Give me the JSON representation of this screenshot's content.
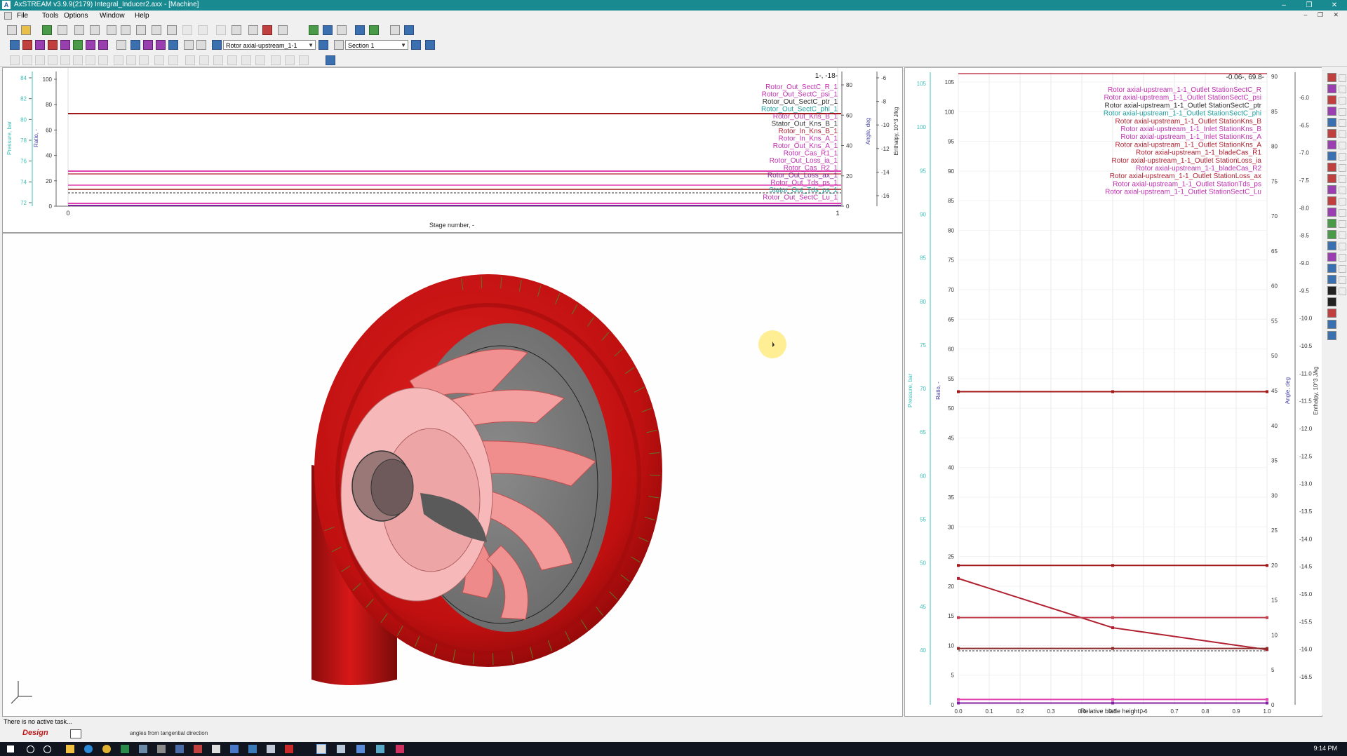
{
  "window": {
    "title": "AxSTREAM  v3.9.9(2179)  Integral_Inducer2.axx - [Machine]",
    "controls": [
      "–",
      "❐",
      "✕"
    ]
  },
  "menu": {
    "items": [
      "File",
      "Tools",
      "Options",
      "Window",
      "Help"
    ]
  },
  "toolbar": {
    "object_select": "Rotor axial-upstream_1-1",
    "section_select": "Section 1"
  },
  "top_chart": {
    "readout": "1-, -18-",
    "x_label": "Stage number, -",
    "y_labels": {
      "pressure": "Pressure, bar",
      "ratio": "Ratio, -",
      "angle": "Angle, deg",
      "enthalpy": "Enthalpy, 10^3 J/kg"
    },
    "colors": {
      "pressure": "#40c0b8",
      "ratio": "#4040a0",
      "angle": "#4040a0",
      "enthalpy": "#303030",
      "dark_red": "#a01818",
      "pink": "#e040b0",
      "purple": "#8020a0"
    },
    "legend": [
      {
        "text": "Rotor_Out_SectC_R_1",
        "color": "#c030b0"
      },
      {
        "text": "Rotor_Out_SectC_psi_1",
        "color": "#c030b0"
      },
      {
        "text": "Rotor_Out_SectC_ptr_1",
        "color": "#303030"
      },
      {
        "text": "Rotor_Out_SectC_phi_1",
        "color": "#20a0a0"
      },
      {
        "text": "Rotor_Out_Kns_B_1",
        "color": "#c030b0"
      },
      {
        "text": "Stator_Out_Kns_B_1",
        "color": "#303030"
      },
      {
        "text": "Rotor_In_Kns_B_1",
        "color": "#b02030"
      },
      {
        "text": "Rotor_In_Kns_A_1",
        "color": "#c030b0"
      },
      {
        "text": "Rotor_Out_Kns_A_1",
        "color": "#c030b0"
      },
      {
        "text": "Rotor_Cas_R1_1",
        "color": "#c030b0"
      },
      {
        "text": "Rotor_Out_Loss_ia_1",
        "color": "#c030b0"
      },
      {
        "text": "Rotor_Cas_R2_1",
        "color": "#c030b0"
      },
      {
        "text": "Rotor_Out_Loss_ax_1",
        "color": "#8020a0"
      },
      {
        "text": "Rotor_Out_Tds_ps_1",
        "color": "#c030b0"
      },
      {
        "text": "Stator_Out_Tds_ps_1",
        "color": "#20a0a0"
      },
      {
        "text": "Rotor_Out_SectC_Lu_1",
        "color": "#c030b0"
      }
    ],
    "axis_pressure_ticks": [
      "84",
      "82",
      "80",
      "78",
      "76",
      "74",
      "72"
    ],
    "axis_ratio_ticks": [
      "100",
      "80",
      "60",
      "40",
      "20",
      "0"
    ],
    "axis_angle_ticks": [
      "80",
      "60",
      "40",
      "20",
      "0"
    ],
    "axis_enthalpy_ticks": [
      "-6",
      "-8",
      "-10",
      "-12",
      "-14",
      "-16"
    ],
    "x_ticks": [
      "0",
      "1"
    ]
  },
  "right_chart": {
    "readout": "-0.06-, 69.8-",
    "x_label": "Relative blade height, -",
    "y_labels": {
      "pressure": "Pressure, bar",
      "ratio": "Ratio, -",
      "angle": "Angle, deg",
      "enthalpy": "Enthalpy, 10^3 J/kg"
    },
    "legend": [
      {
        "text": "Rotor axial-upstream_1-1_Outlet StationSectC_R",
        "color": "#c030b0"
      },
      {
        "text": "Rotor axial-upstream_1-1_Outlet StationSectC_psi",
        "color": "#c030b0"
      },
      {
        "text": "Rotor axial-upstream_1-1_Outlet StationSectC_ptr",
        "color": "#303030"
      },
      {
        "text": "Rotor axial-upstream_1-1_Outlet StationSectC_phi",
        "color": "#20a0a0"
      },
      {
        "text": "Rotor axial-upstream_1-1_Outlet StationKns_B",
        "color": "#b02030"
      },
      {
        "text": "Rotor axial-upstream_1-1_Inlet StationKns_B",
        "color": "#c030b0"
      },
      {
        "text": "Rotor axial-upstream_1-1_Inlet StationKns_A",
        "color": "#c030b0"
      },
      {
        "text": "Rotor axial-upstream_1-1_Outlet StationKns_A",
        "color": "#b02030"
      },
      {
        "text": "Rotor axial-upstream_1-1_bladeCas_R1",
        "color": "#b02030"
      },
      {
        "text": "Rotor axial-upstream_1-1_Outlet StationLoss_ia",
        "color": "#b02030"
      },
      {
        "text": "Rotor axial-upstream_1-1_bladeCas_R2",
        "color": "#c030b0"
      },
      {
        "text": "Rotor axial-upstream_1-1_Outlet StationLoss_ax",
        "color": "#b02030"
      },
      {
        "text": "Rotor axial-upstream_1-1_Outlet StationTds_ps",
        "color": "#c030b0"
      },
      {
        "text": "Rotor axial-upstream_1-1_Outlet StationSectC_Lu",
        "color": "#c030b0"
      }
    ],
    "axis_pressure_ticks": [
      "105",
      "100",
      "95",
      "90",
      "85",
      "80",
      "75",
      "70",
      "65",
      "60",
      "55",
      "50",
      "45",
      "40"
    ],
    "axis_ratio_ticks": [
      "105",
      "100",
      "95",
      "90",
      "85",
      "80",
      "75",
      "70",
      "65",
      "60",
      "55",
      "50",
      "45",
      "40",
      "35",
      "30",
      "25",
      "20",
      "15",
      "10",
      "5",
      "0"
    ],
    "axis_angle_ticks": [
      "90",
      "85",
      "80",
      "75",
      "70",
      "65",
      "60",
      "55",
      "50",
      "45",
      "40",
      "35",
      "30",
      "25",
      "20",
      "15",
      "10",
      "5",
      "0"
    ],
    "axis_enthalpy_ticks": [
      "-6.0",
      "-6.5",
      "-7.0",
      "-7.5",
      "-8.0",
      "-8.5",
      "-9.0",
      "-9.5",
      "-10.0",
      "-10.5",
      "-11.0",
      "-11.5",
      "-12.0",
      "-12.5",
      "-13.0",
      "-13.5",
      "-14.0",
      "-14.5",
      "-15.0",
      "-15.5",
      "-16.0",
      "-16.5"
    ],
    "x_ticks": [
      "0.0",
      "0.1",
      "0.2",
      "0.3",
      "0.4",
      "0.5",
      "0.6",
      "0.7",
      "0.8",
      "0.9",
      "1.0"
    ],
    "series": [
      {
        "x": [
          0.0,
          0.5,
          1.0
        ],
        "y": [
          52.8,
          52.8,
          52.8
        ],
        "color": "#a01818"
      },
      {
        "x": [
          0.0,
          0.5,
          1.0
        ],
        "y": [
          23.5,
          23.5,
          23.5
        ],
        "color": "#a01818"
      },
      {
        "x": [
          0.0,
          0.5,
          1.0
        ],
        "y": [
          21.3,
          13.0,
          9.3
        ],
        "color": "#b02030"
      },
      {
        "x": [
          0.0,
          0.5,
          1.0
        ],
        "y": [
          14.7,
          14.7,
          14.7
        ],
        "color": "#c04050"
      },
      {
        "x": [
          0.0,
          0.5,
          1.0
        ],
        "y": [
          9.5,
          9.5,
          9.5
        ],
        "color": "#8a2a2a"
      },
      {
        "x": [
          0.0,
          0.5,
          1.0
        ],
        "y": [
          0.9,
          0.9,
          0.9
        ],
        "color": "#e040b0"
      },
      {
        "x": [
          0.0,
          0.5,
          1.0
        ],
        "y": [
          0.3,
          0.3,
          0.3
        ],
        "color": "#8020a0"
      }
    ]
  },
  "status": {
    "task": "There is no active task...",
    "mode": "Design",
    "hint": "angles from tangential direction"
  },
  "taskbar": {
    "clock": "9:14 PM"
  }
}
